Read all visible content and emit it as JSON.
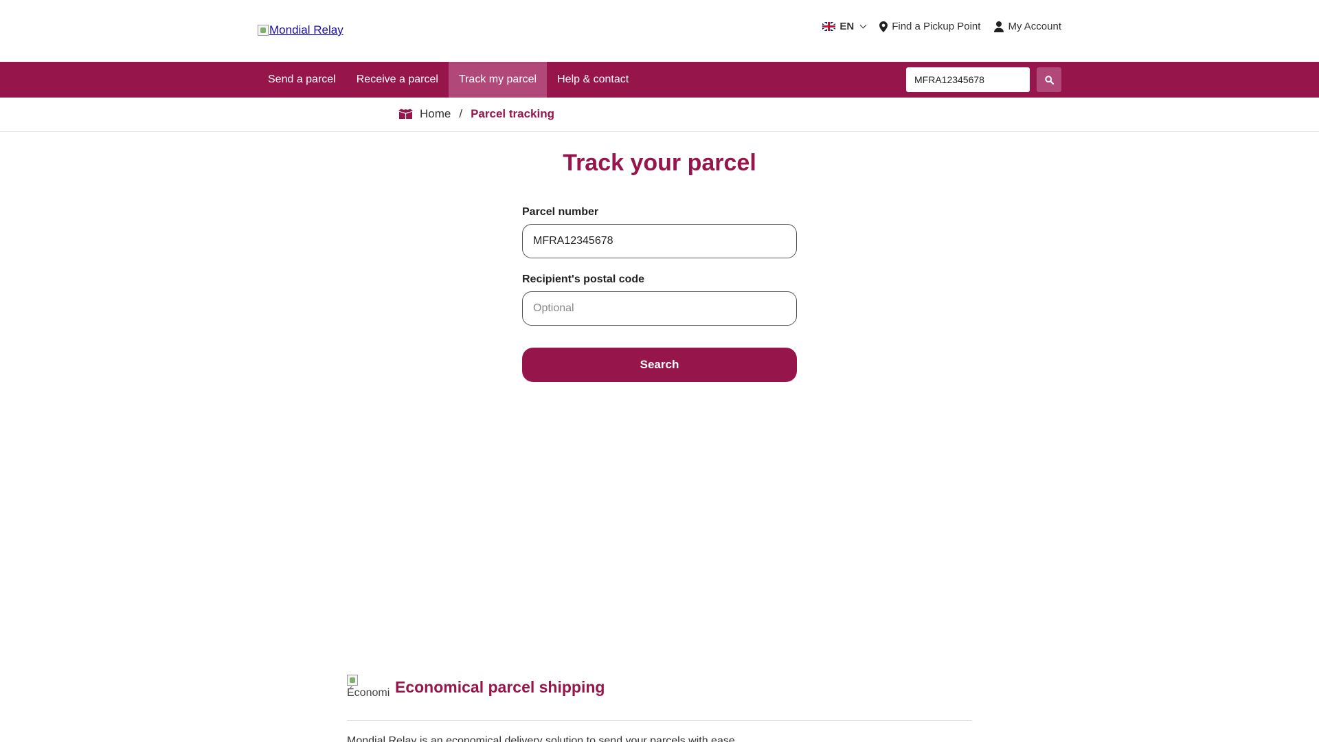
{
  "header": {
    "logo_alt": "Mondial Relay",
    "language": "EN",
    "find_pickup": "Find a Pickup Point",
    "my_account": "My Account"
  },
  "nav": {
    "items": [
      {
        "label": "Send a parcel"
      },
      {
        "label": "Receive a parcel"
      },
      {
        "label": "Track my parcel",
        "active": true
      },
      {
        "label": "Help & contact"
      }
    ],
    "search_value": "MFRA12345678"
  },
  "breadcrumb": {
    "home": "Home",
    "separator": "/",
    "current": "Parcel tracking"
  },
  "main": {
    "title": "Track your parcel",
    "parcel_label": "Parcel number",
    "parcel_value": "MFRA12345678",
    "postal_label": "Recipient's postal code",
    "postal_placeholder": "Optional",
    "search_button": "Search"
  },
  "section": {
    "image_alt": "Économi",
    "title": "Economical parcel shipping",
    "text": "Mondial Relay is an economical delivery solution to send your parcels with ease."
  },
  "colors": {
    "brand": "#96154a",
    "nav_active": "#b1487a"
  }
}
